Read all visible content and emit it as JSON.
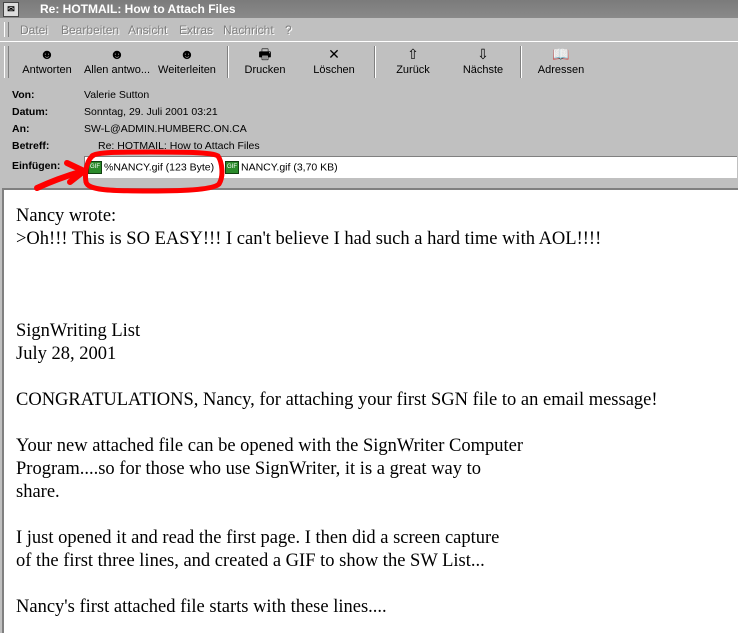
{
  "window": {
    "title": "Re: HOTMAIL: How to Attach Files",
    "accent_color": "#808080"
  },
  "menu": [
    "Datei",
    "Bearbeiten",
    "Ansicht",
    "Extras",
    "Nachricht",
    "?"
  ],
  "toolbar": {
    "buttons": [
      {
        "label": "Antworten",
        "icon": "reply-icon"
      },
      {
        "label": "Allen antwo...",
        "icon": "reply-all-icon"
      },
      {
        "label": "Weiterleiten",
        "icon": "forward-icon"
      },
      {
        "label": "Drucken",
        "icon": "printer-icon"
      },
      {
        "label": "Löschen",
        "icon": "delete-x-icon"
      },
      {
        "label": "Zurück",
        "icon": "up-arrow-icon"
      },
      {
        "label": "Nächste",
        "icon": "down-arrow-icon"
      },
      {
        "label": "Adressen",
        "icon": "address-book-icon"
      }
    ]
  },
  "header": {
    "from_label": "Von:",
    "from_value": "Valerie Sutton",
    "date_label": "Datum:",
    "date_value": "Sonntag, 29. Juli 2001 03:21",
    "to_label": "An:",
    "to_value": "SW-L@ADMIN.HUMBERC.ON.CA",
    "subject_label": "Betreff:",
    "subject_value": "Re: HOTMAIL: How to Attach Files",
    "attach_label": "Einfügen:",
    "attachments": [
      "%NANCY.gif (123 Byte)",
      "NANCY.gif (3,70 KB)"
    ]
  },
  "annotation_color": "#ff0000",
  "body": {
    "lines": [
      "Nancy wrote:",
      ">Oh!!!  This is SO EASY!!!  I can't believe I had such a hard time with AOL!!!!",
      "SignWriting List",
      "July 28, 2001",
      "CONGRATULATIONS, Nancy, for attaching your first SGN file to an email message!",
      "Your new attached file can be opened with the SignWriter Computer",
      "Program....so for those who use SignWriter, it is a great way to",
      "share.",
      "I just opened it and read the first page. I then did a screen capture",
      "of the first three lines, and created a GIF to show the SW List...",
      "Nancy's first attached file starts with these lines...."
    ]
  }
}
